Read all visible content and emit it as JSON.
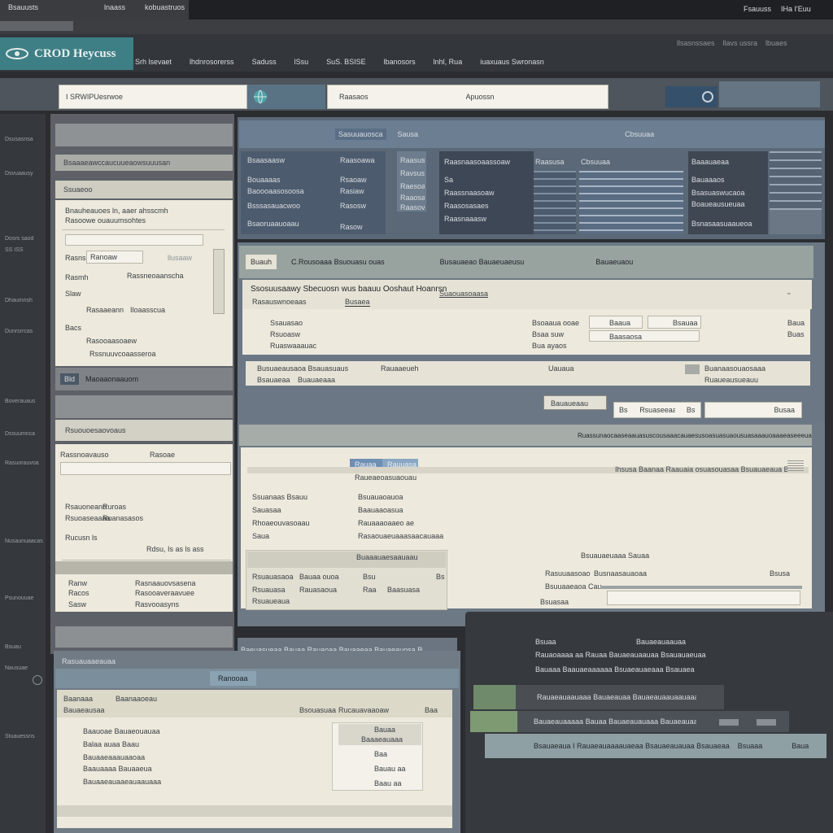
{
  "colors": {
    "bg": "#2b2d31",
    "accent": "#3e7f86",
    "slate": "#4d5b6e",
    "cream": "#ede9dc",
    "blue": "#6f8fb3"
  },
  "topbar": {
    "left1": "Bsauusts",
    "left2": "lnaass",
    "left3": "kobuastruos",
    "right1": "Fsauuss",
    "right2": "IHa I'Euu"
  },
  "app": {
    "logo_text": "CROD Heycuss",
    "logo_icon": "orbit-icon"
  },
  "menu": [
    "Srh lsevaet",
    "lhdnrosorerss",
    "Saduss",
    "lSsu",
    "SuS. BSISE",
    "lbanosors",
    "lnhl, Rua",
    "iuaxuaus Swronasn"
  ],
  "menu_right": [
    "llsasnssaes",
    "llavs ussra",
    "lbuaes"
  ],
  "search": {
    "value": "I SRWIPUesrwoe",
    "label1": "Raasaos",
    "label2": "Apuossn",
    "icon": "globe-icon",
    "go_icon": "ring-icon"
  },
  "left_sidebar": [
    "Dsusasnsa",
    "Dsvuaausy",
    "Dosrs saod",
    "SS ISS",
    "Dhaumnsh",
    "Dunrsrrcas",
    "Boverauaus",
    "Dssuumnca",
    "Rasuorauvoa",
    "Nusaunuaacas",
    "Psunouuae",
    "Bsuau",
    "Nausuae",
    "Stuauessns"
  ],
  "left_panel": {
    "header": "",
    "title": "Bsaaaeawccaucuueaowsuuusan",
    "subtitle": "Ssuaeoo",
    "note1": "Bnauheauoes ln, aaer ahsscmh",
    "note2": "Rasoowe ouauumsohtes",
    "form_rows": [
      {
        "label": "Rasns",
        "value": "Ranoaw",
        "extra": "llusaaw"
      },
      {
        "label": "Rasmh",
        "value": "Rassneoaanscha",
        "extra": ""
      },
      {
        "label": "Slaw",
        "value": "Rasaaeann",
        "extra": "Iloaasscua"
      },
      {
        "label": "Bacs",
        "value": "Rasooaasoaew",
        "extra": ""
      },
      {
        "label": "",
        "value": "Rssnuuvcoaasseroa",
        "extra": ""
      }
    ],
    "section_badge": "Bld",
    "section_title": "Maoaaonaauom",
    "sub2_title": "Rsuouoesaovoaus",
    "list_header_a": "Rassnoavauso",
    "list_header_b": "Rasoae",
    "list_rows": [
      {
        "a": "Rsauoneano",
        "b": "Ruroas"
      },
      {
        "a": "Rsuoaseaaaa",
        "b": "Ruanasasos"
      },
      {
        "a": "Rucusn ls",
        "b": "Rdsu, Is as ls ass"
      },
      {
        "a": "Ranw",
        "b": "Rasnaauovsasena"
      },
      {
        "a": "Racos",
        "b": "Rasooaveraavuee"
      },
      {
        "a": "Sasw",
        "b": "Rasvooasyns"
      }
    ]
  },
  "top_grid": {
    "title": "Sasuuauosca",
    "chip": "Sausa",
    "right_label": "Cbsuuaa",
    "left_rows": [
      "Bsaasaasw",
      "Bouaaaas",
      "Baoooaasosoosa",
      "Bsssasauacwoo",
      "Bsaoruaauoaau"
    ],
    "left_vals": [
      "Raasoawa",
      "Rsaoaw",
      "Rasiaw",
      "Rasosw",
      "Rasow"
    ],
    "mid_col": [
      "Raasusaow",
      "Ravsus",
      "Raesoaw",
      "Raaosas",
      "Raasov"
    ],
    "col3_head": "Raasnaasoaassoaw",
    "col3_rows": [
      "Sa",
      "Raassnaasoaw",
      "Raasosasaes",
      "Raasnaaasw"
    ],
    "col4_head": "Raasusa",
    "col5_head": "Cbsuuaa",
    "col6_head": "Baaauaeaa",
    "col6_rows": [
      "Bauaaaos",
      "Bsasuaswucaoa",
      "Boaueausueuaa",
      "Bsnasaasuaaueoa"
    ]
  },
  "detail": {
    "tab_badge": "Buauh",
    "tab_title": "C.Rousoaaa Bsuouasu ouas",
    "tab_meta": "Busauaeao Bauaeuaeusu",
    "tab_right": "Bauaeuaou",
    "heading": "Ssosuusaawy Sbecuosn wus baauu Ooshaut Hoanrsn",
    "heading_link": "Suaouasoaasa",
    "sub_left": "Rasauswnoeaas",
    "sub_mid": "Busaea",
    "info_rows": [
      {
        "label": "Ssauasao",
        "v1": "Bsoaaua ooae",
        "v2": "Baaua",
        "v3": "Bsauaa",
        "v4": "Baua"
      },
      {
        "label": "Rsuoasw",
        "v1": "Bsaa suw",
        "v2": "Baasaosa",
        "v3": "",
        "v4": "Buas"
      },
      {
        "label": "Ruaswaaauac",
        "v1": "Bua ayaos",
        "v2": "",
        "v3": "",
        "v4": ""
      }
    ],
    "tax_row": {
      "label": "Busuaeausaoa  Bsauasuaus",
      "mid": "Rauaaeueh",
      "right": "Uauaua",
      "r2": "Buanaasouaosaaa",
      "r3": "Bsauaeaa",
      "r4": "Buauaeaaa",
      "r5": "Ruaueausueauu"
    },
    "actions": {
      "select": "Bauaueaau",
      "field1": "Bsu",
      "field1b": "Rsuaseeaaaae",
      "field1c": "Bsu",
      "field2": "Busaa"
    }
  },
  "lower": {
    "header": "Ruassunaocaaseaauasuscousaaacauaesusoasuasuaousuasaaauoaaaeaseeeuauo",
    "chip1": "Rauaa",
    "chip2": "Rauuasa",
    "chip_sub": "Raueaeoasuaouau",
    "long_text": "Ihsusa Baanaa Raauaia osuasouasaa Bsuauaeaua Bsaaeuaa Rac",
    "fields": [
      {
        "label": "Ssuanaas Bsauu",
        "value": "Bsuauaoauoa"
      },
      {
        "label": "Sauasaa",
        "value": "Baauaaoasua"
      },
      {
        "label": "Rhoaeouvasoaau",
        "value": "Rauaaaoaaeo ae"
      },
      {
        "label": "Saua",
        "value": "Rasaouaeuaaasaacauaaa"
      }
    ],
    "sub_table_title": "Buaaauaesaauaau",
    "sub_table": [
      {
        "a": "Rsuauasaoa",
        "b": "Bauaa ouoa",
        "c": "Bsu",
        "d": "Bs"
      },
      {
        "a": "Rsuauasa",
        "b": "Rauasaoua",
        "c": "Raa",
        "d": "Baasuasa"
      },
      {
        "a": "Rsuaueaua",
        "b": "",
        "c": "",
        "d": ""
      }
    ],
    "right_title": "Bsuauaeuaaa Sauaa",
    "right_rows": [
      {
        "label": "Rasuuaasoao",
        "value": "Busnaasauaoaa"
      },
      {
        "label": "Bsuuaaeaoa Cau",
        "value": "Bsusa"
      }
    ],
    "right_input": "Bsuasaa"
  },
  "bottom_left": {
    "ticker": "Baeuasueaa Bauaa Rauaoaa Bauaaeaa Bauaeauosa Bsaeuaaa",
    "head": "Rasuauaaeauaa",
    "sub": "Bsouasuaa",
    "tab1": "Ranooaa",
    "tab2": "Rucauavaaoaw",
    "col1": "Baanaaa",
    "col2": "Baanaaoeau",
    "col3": "Bauaeausaa",
    "col4": "Baa",
    "items": [
      "Baauoae  Bauaeouauaa",
      "Balaa auaa Baau",
      "Bauaaeaaauaaoaa",
      "Baauaaaa Bauaaeua",
      "Bauaaeauaaeauaauaaa"
    ],
    "side_head": "Bauaa",
    "side_sub": "Baaaeauaaa",
    "side_rows": [
      "Baa",
      "Bauau aa",
      "Baau aa"
    ]
  },
  "bottom_right": {
    "label": "Bsuaa",
    "label_value": "Bauaeauaauaa",
    "line1": "Rauaoaaaa aa Rauaa Bauaeauaauaa Bsauauaeuaaa Bsauaa",
    "line2": "Bauaaa Baauaeaaaaaa Bsuaeauaeaaa Bsauaeaa",
    "bar1": "Rauaeauaauaaa Bauaeauaa Bauaeauaauaauaaa",
    "bar2": "Bauaeauaaaaa Bauaa Bauaeauauaaa Bauaeauaa",
    "footer": "Bsauaeaua I Rauaeauaaaauaeaa Bsauaeauauaa Bsauaeaa",
    "footer_right": "Bsuaaa",
    "footer_far": "Baua"
  }
}
